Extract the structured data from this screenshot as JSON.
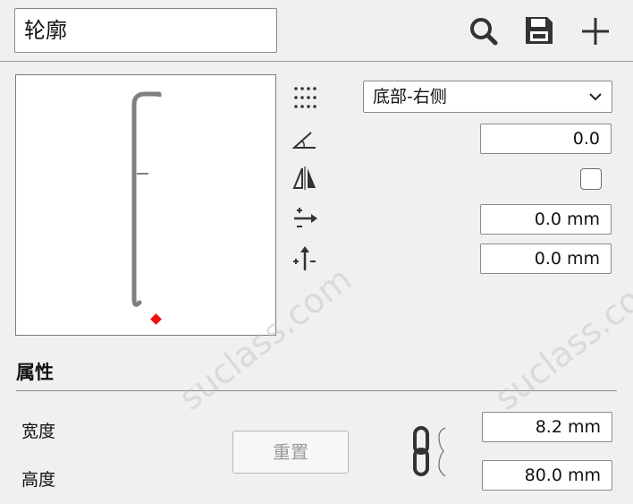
{
  "header": {
    "profile_name": "轮廓"
  },
  "toolbar": {
    "search_icon": "search-icon",
    "save_icon": "save-icon",
    "add_icon": "plus-icon"
  },
  "placement": {
    "anchor_value": "底部-右侧",
    "angle_value": "0.0",
    "mirror_checked": false,
    "offset_x_value": "0.0 mm",
    "offset_y_value": "0.0 mm"
  },
  "properties": {
    "title": "属性",
    "width_label": "宽度",
    "height_label": "高度",
    "width_value": "8.2 mm",
    "height_value": "80.0 mm",
    "reset_label": "重置"
  },
  "watermarks": [
    "suclass.com",
    "suclass.com"
  ]
}
